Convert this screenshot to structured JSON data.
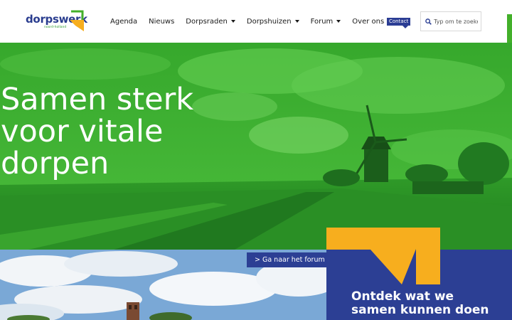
{
  "colors": {
    "brand_blue": "#2c3f94",
    "brand_green": "#43b02a",
    "brand_yellow": "#f7ae1e",
    "hero_overlay": "#3fb330"
  },
  "logo": {
    "word": "dorpswerk",
    "tagline": "noord-holland"
  },
  "nav": {
    "items": [
      {
        "label": "Agenda",
        "dropdown": false
      },
      {
        "label": "Nieuws",
        "dropdown": false
      },
      {
        "label": "Dorpsraden",
        "dropdown": true
      },
      {
        "label": "Dorpshuizen",
        "dropdown": true
      },
      {
        "label": "Forum",
        "dropdown": true
      },
      {
        "label": "Over ons",
        "dropdown": true
      }
    ],
    "contact_label": "Contact"
  },
  "search": {
    "icon": "search-icon",
    "placeholder": "Typ om te zoeken"
  },
  "hero": {
    "title": "Samen sterk voor vitale dorpen"
  },
  "forum_link": {
    "label": "> Ga naar het forum"
  },
  "panel": {
    "title": "Ontdek wat we samen kunnen doen"
  }
}
